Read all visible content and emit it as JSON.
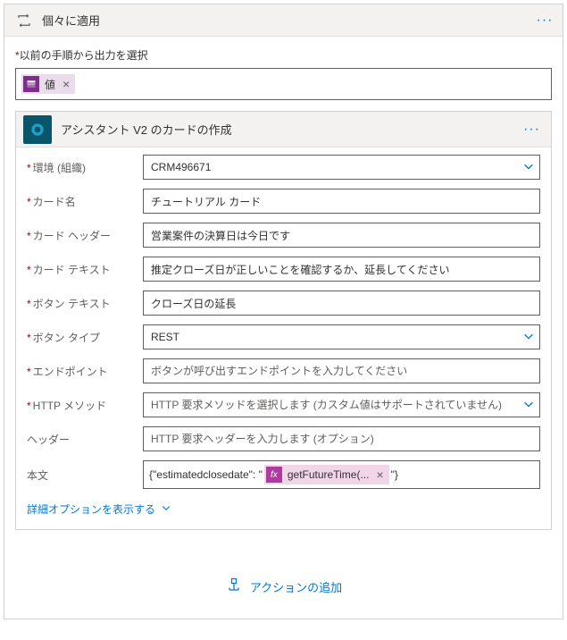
{
  "outer": {
    "title": "個々に適用",
    "prevOutputLabel": "以前の手順から出力を選択",
    "tokenLabel": "値"
  },
  "inner": {
    "title": "アシスタント V2 のカードの作成",
    "fields": {
      "env": {
        "label": "環境 (組織)",
        "value": "CRM496671"
      },
      "cardName": {
        "label": "カード名",
        "value": "チュートリアル カード"
      },
      "cardHeader": {
        "label": "カード ヘッダー",
        "value": "営業案件の決算日は今日です"
      },
      "cardText": {
        "label": "カード テキスト",
        "value": "推定クローズ日が正しいことを確認するか、延長してください"
      },
      "buttonText": {
        "label": "ボタン テキスト",
        "value": "クローズ日の延長"
      },
      "buttonType": {
        "label": "ボタン タイプ",
        "value": "REST"
      },
      "endpoint": {
        "label": "エンドポイント",
        "placeholder": "ボタンが呼び出すエンドポイントを入力してください"
      },
      "httpMethod": {
        "label": "HTTP メソッド",
        "placeholder": "HTTP 要求メソッドを選択します (カスタム値はサポートされていません)"
      },
      "headers": {
        "label": "ヘッダー",
        "placeholder": "HTTP 要求ヘッダーを入力します (オプション)"
      },
      "body": {
        "label": "本文",
        "prefix": "{\"estimatedclosedate\": \"",
        "fxLabel": "getFutureTime(...",
        "suffix": "\"}"
      }
    },
    "advancedLabel": "詳細オプションを表示する"
  },
  "addAction": "アクションの追加"
}
